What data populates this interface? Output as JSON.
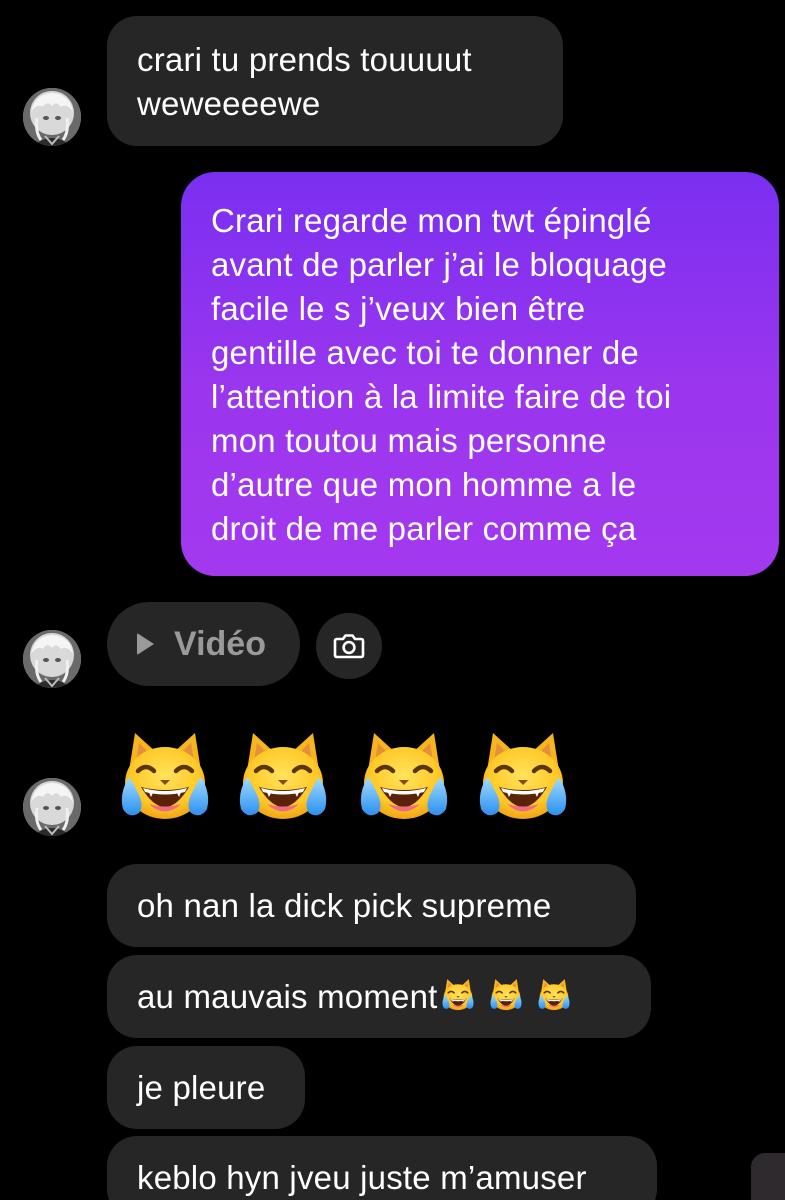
{
  "messages": {
    "m1": {
      "lines": [
        "crari tu prends touuuut",
        "weweeeewe"
      ]
    },
    "m2": {
      "lines": [
        "Crari regarde mon twt épinglé",
        "avant de parler j’ai le bloquage",
        "facile le s j’veux bien être",
        "gentille avec toi te donner de",
        "l’attention à la limite faire de toi",
        "mon toutou mais personne",
        "d’autre que mon homme a le",
        "droit de me parler comme ça"
      ]
    },
    "video": {
      "label": "Vidéo"
    },
    "m4": {
      "text": "oh nan la dick pick supreme"
    },
    "m5": {
      "text": "au mauvais moment"
    },
    "m6": {
      "text": "je pleure"
    },
    "m7": {
      "text": "keblo hyn jveu juste m’amuser"
    }
  },
  "icons": {
    "play": "play-icon",
    "camera": "camera-icon",
    "emoji": "cat-tears-of-joy-emoji"
  },
  "colors": {
    "background": "#000000",
    "incoming_bubble": "#262626",
    "outgoing_gradient_top": "#7a2ff0",
    "outgoing_gradient_bottom": "#a339ef",
    "muted_text": "#9a9a9a"
  }
}
